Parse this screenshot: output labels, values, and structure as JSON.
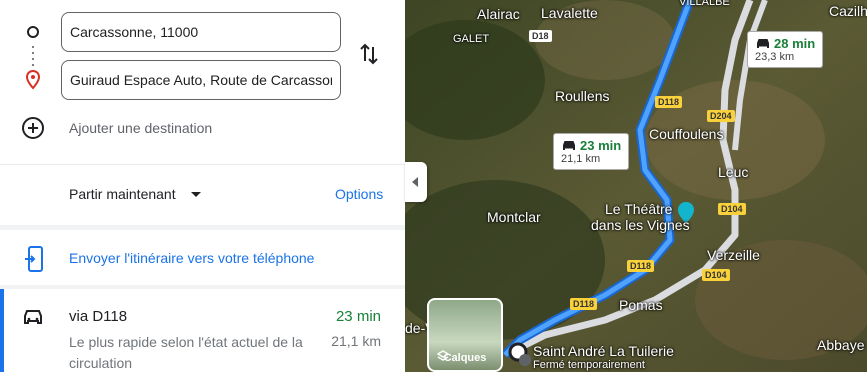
{
  "directions": {
    "origin": "Carcassonne, 11000",
    "destination": "Guiraud Espace Auto, Route de Carcassonne",
    "add_destination": "Ajouter une destination",
    "depart_label": "Partir maintenant",
    "options_label": "Options",
    "send_to_phone": "Envoyer l'itinéraire vers votre téléphone"
  },
  "route": {
    "name": "via D118",
    "description": "Le plus rapide selon l'état actuel de la circulation",
    "time": "23 min",
    "distance": "21,1 km"
  },
  "map": {
    "places": [
      "Alairac",
      "Lavalette",
      "GALET",
      "Roullens",
      "Couffoulens",
      "Leuc",
      "Montclar",
      "Le Théâtre",
      "dans les Vignes",
      "Verzeille",
      "Pomas",
      "Saint André La Tuilerie",
      "Fermé temporairement",
      "Abbaye",
      "Cazilh",
      "de-V",
      "VILLALBE"
    ],
    "roads": [
      "D18",
      "D118",
      "D204",
      "D104",
      "D118",
      "D104",
      "D118"
    ],
    "bubble_main": {
      "time": "23 min",
      "distance": "21,1 km"
    },
    "bubble_alt": {
      "time": "28 min",
      "distance": "23,3 km"
    },
    "layers_label": "Calques"
  },
  "colors": {
    "accent": "#1a73e8",
    "time_green": "#188038"
  }
}
